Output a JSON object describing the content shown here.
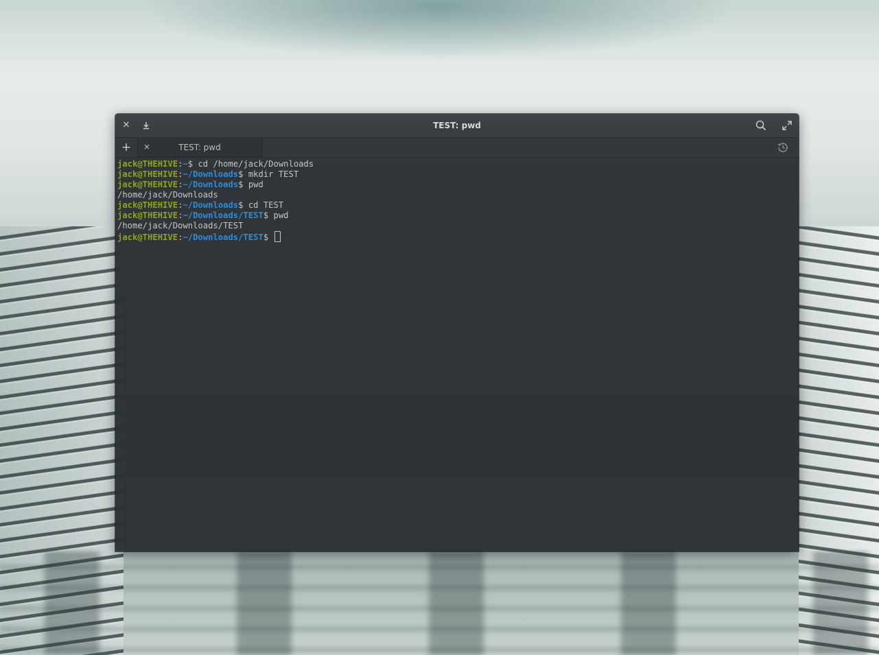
{
  "window": {
    "title": "TEST: pwd"
  },
  "titlebar": {
    "close_icon": "close-icon",
    "download_icon": "download-icon",
    "search_icon": "search-icon",
    "maximize_icon": "maximize-icon"
  },
  "tabbar": {
    "new_tab_icon": "plus-icon",
    "tabs": [
      {
        "label": "TEST: pwd",
        "close_icon": "close-icon"
      }
    ],
    "history_icon": "history-icon"
  },
  "terminal": {
    "lines": [
      {
        "user": "jack@THEHIVE",
        "sep": ":",
        "path": "~",
        "prompt": "$ ",
        "text": "cd /home/jack/Downloads"
      },
      {
        "user": "jack@THEHIVE",
        "sep": ":",
        "path": "~/Downloads",
        "prompt": "$ ",
        "text": "mkdir TEST"
      },
      {
        "user": "jack@THEHIVE",
        "sep": ":",
        "path": "~/Downloads",
        "prompt": "$ ",
        "text": "pwd"
      },
      {
        "output": "/home/jack/Downloads"
      },
      {
        "user": "jack@THEHIVE",
        "sep": ":",
        "path": "~/Downloads",
        "prompt": "$ ",
        "text": "cd TEST"
      },
      {
        "user": "jack@THEHIVE",
        "sep": ":",
        "path": "~/Downloads/TEST",
        "prompt": "$ ",
        "text": "pwd"
      },
      {
        "output": "/home/jack/Downloads/TEST"
      },
      {
        "user": "jack@THEHIVE",
        "sep": ":",
        "path": "~/Downloads/TEST",
        "prompt": "$ ",
        "text": ""
      }
    ]
  },
  "colors": {
    "user": "#8fa31c",
    "path": "#2e8bd8",
    "text": "#c3c6c8",
    "background": "#2b3034"
  }
}
